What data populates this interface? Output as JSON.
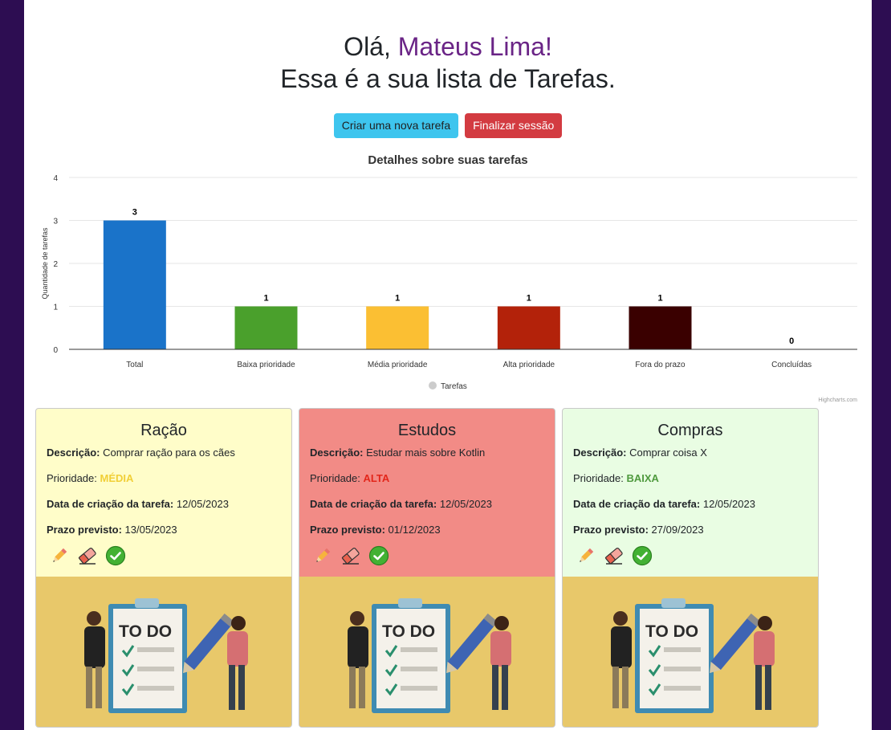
{
  "greeting": {
    "prefix": "Olá, ",
    "name": "Mateus Lima!",
    "subtitle": "Essa é a sua lista de Tarefas."
  },
  "buttons": {
    "new_task": "Criar uma nova tarefa",
    "logout": "Finalizar sessão"
  },
  "chart_data": {
    "type": "bar",
    "title": "Detalhes sobre suas tarefas",
    "ylabel": "Quantidade de tarefas",
    "ylim": [
      0,
      4
    ],
    "yticks": [
      "0",
      "1",
      "2",
      "3",
      "4"
    ],
    "categories": [
      "Total",
      "Baixa prioridade",
      "Média prioridade",
      "Alta prioridade",
      "Fora do prazo",
      "Concluídas"
    ],
    "series": [
      {
        "name": "Tarefas",
        "values": [
          3,
          1,
          1,
          1,
          1,
          0
        ]
      }
    ],
    "colors": [
      "#1a73c9",
      "#4aa02c",
      "#fbbf33",
      "#b3220a",
      "#3a0000",
      "#888888"
    ],
    "legend_position": "bottom",
    "grid": true,
    "credits": "Highcharts.com"
  },
  "cards": [
    {
      "title": "Ração",
      "bg": "#fffdc9",
      "desc_label": "Descrição:",
      "desc": "Comprar ração para os cães",
      "prio_label": "Prioridade:",
      "prio": "MÉDIA",
      "prio_color": "#f1cf37",
      "created_label": "Data de criação da tarefa:",
      "created": "12/05/2023",
      "due_label": "Prazo previsto:",
      "due": "13/05/2023",
      "image_text": "TO DO"
    },
    {
      "title": "Estudos",
      "bg": "#f28b86",
      "desc_label": "Descrição:",
      "desc": "Estudar mais sobre Kotlin",
      "prio_label": "Prioridade:",
      "prio": "ALTA",
      "prio_color": "#e3261a",
      "created_label": "Data de criação da tarefa:",
      "created": "12/05/2023",
      "due_label": "Prazo previsto:",
      "due": "01/12/2023",
      "image_text": "TO DO"
    },
    {
      "title": "Compras",
      "bg": "#e9fde3",
      "desc_label": "Descrição:",
      "desc": "Comprar coisa X",
      "prio_label": "Prioridade:",
      "prio": "BAIXA",
      "prio_color": "#4f9a3e",
      "created_label": "Data de criação da tarefa:",
      "created": "12/05/2023",
      "due_label": "Prazo previsto:",
      "due": "27/09/2023",
      "image_text": "TO DO"
    }
  ],
  "card_icons": [
    "pencil-icon",
    "eraser-icon",
    "check-icon"
  ]
}
